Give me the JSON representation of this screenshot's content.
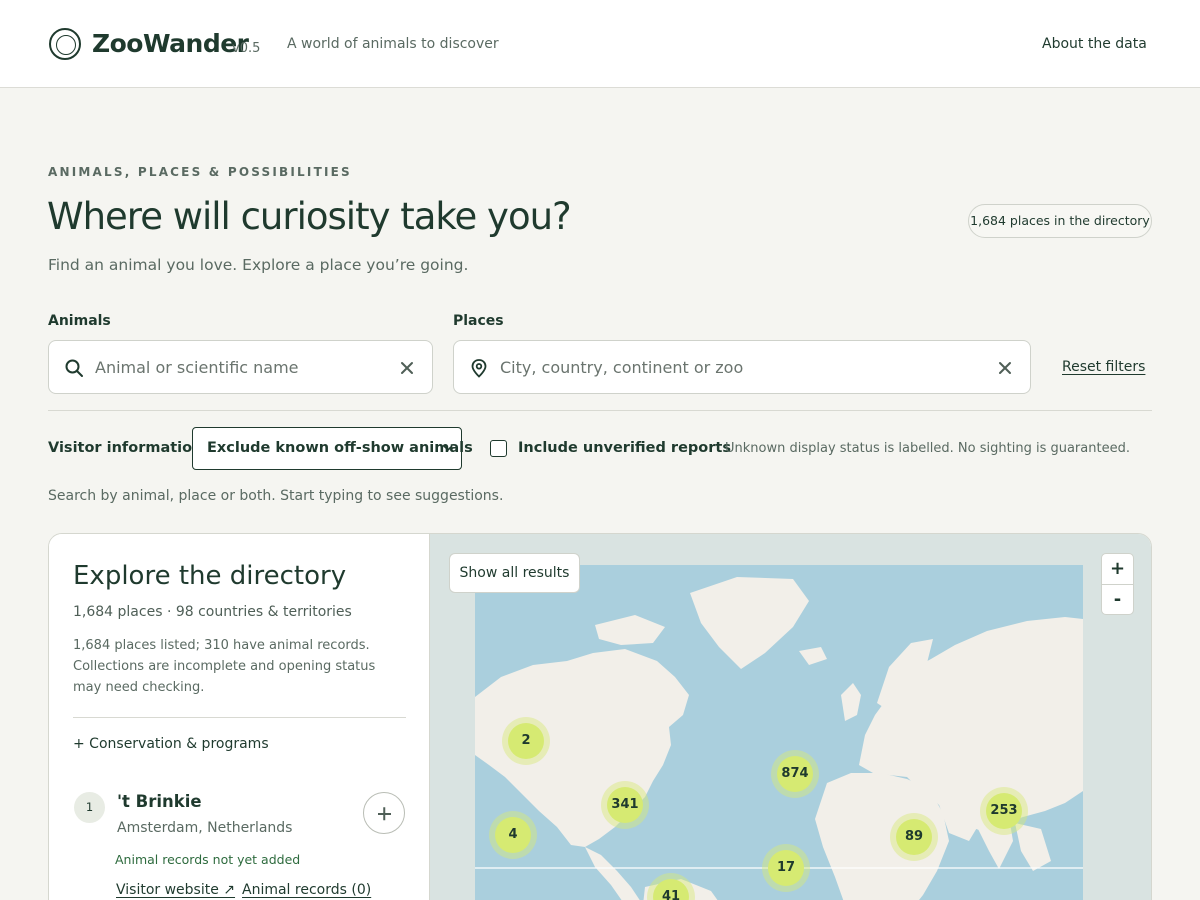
{
  "header": {
    "brand": "ZooWander",
    "version": "v0.5",
    "tagline": "A world of animals to discover",
    "about_link": "About the data"
  },
  "hero": {
    "eyebrow": "ANIMALS, PLACES & POSSIBILITIES",
    "title": "Where will curiosity take you?",
    "subtitle": "Find an animal you love. Explore a place you’re going.",
    "count_badge": "1,684 places in the directory"
  },
  "search": {
    "animals_label": "Animals",
    "animals_placeholder": "Animal or scientific name",
    "animals_value": "",
    "places_label": "Places",
    "places_placeholder": "City, country, continent or zoo",
    "places_value": "",
    "reset_label": "Reset filters"
  },
  "filters": {
    "visitor_label": "Visitor information",
    "visitor_selected": "Exclude known off-show animals",
    "unverified_label": "Include unverified reports",
    "unverified_checked": false,
    "status_note": "Unknown display status is labelled. No sighting is guaranteed.",
    "hint": "Search by animal, place or both. Start typing to see suggestions."
  },
  "directory": {
    "title": "Explore the directory",
    "meta": "1,684 places · 98 countries & territories",
    "description": "1,684 places listed; 310 have animal records. Collections are incomplete and opening status may need checking.",
    "conservation_label": "+  Conservation & programs",
    "results": [
      {
        "rank": "1",
        "name": "'t Brinkie",
        "location": "Amsterdam, Netherlands",
        "records_note": "Animal records not yet added",
        "website_link": "Visitor website ↗",
        "records_link": "Animal records (0)"
      }
    ]
  },
  "map": {
    "show_all_label": "Show all results",
    "zoom_in_label": "+",
    "zoom_out_label": "-",
    "clusters": [
      {
        "label": "2",
        "region": "Alaska"
      },
      {
        "label": "874",
        "region": "Europe"
      },
      {
        "label": "341",
        "region": "North America"
      },
      {
        "label": "253",
        "region": "East Asia"
      },
      {
        "label": "4",
        "region": "Pacific / Hawaii"
      },
      {
        "label": "89",
        "region": "South Asia"
      },
      {
        "label": "17",
        "region": "West Africa"
      },
      {
        "label": "41",
        "region": "South America"
      }
    ],
    "colors": {
      "water": "#aacfdd",
      "land": "#f2efe9",
      "cluster": "#d6ea72"
    }
  }
}
